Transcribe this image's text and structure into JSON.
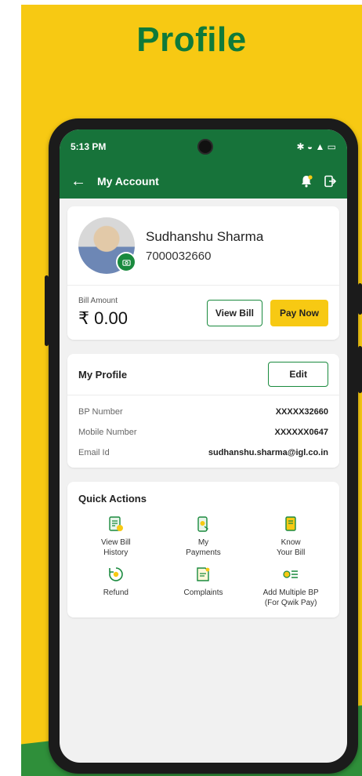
{
  "poster": {
    "title": "Profile"
  },
  "status": {
    "time": "5:13 PM",
    "icons": "✱ ◒ ▲ ▭"
  },
  "appbar": {
    "back_icon": "←",
    "title": "My Account"
  },
  "user": {
    "name": "Sudhanshu Sharma",
    "phone": "7000032660"
  },
  "bill": {
    "label": "Bill Amount",
    "amount": "₹ 0.00",
    "view_label": "View Bill",
    "pay_label": "Pay Now"
  },
  "profile": {
    "title": "My Profile",
    "edit_label": "Edit",
    "fields": [
      {
        "label": "BP Number",
        "value": "XXXXX32660"
      },
      {
        "label": "Mobile Number",
        "value": "XXXXXX0647"
      },
      {
        "label": "Email Id",
        "value": "sudhanshu.sharma@igl.co.in"
      }
    ]
  },
  "quick_actions": {
    "title": "Quick Actions",
    "items": [
      {
        "label": "View Bill\nHistory"
      },
      {
        "label": "My\nPayments"
      },
      {
        "label": "Know\nYour Bill"
      },
      {
        "label": "Refund"
      },
      {
        "label": "Complaints"
      },
      {
        "label": "Add Multiple BP\n(For Qwik Pay)"
      }
    ]
  },
  "colors": {
    "brand_green": "#17733a",
    "accent_yellow": "#f7c913"
  }
}
